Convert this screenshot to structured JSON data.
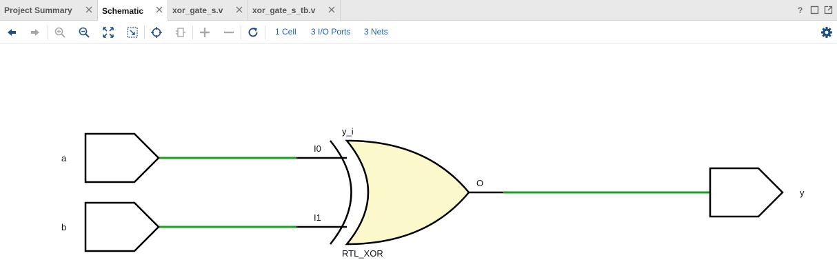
{
  "tabs": [
    {
      "label": "Project Summary",
      "active": false
    },
    {
      "label": "Schematic",
      "active": true
    },
    {
      "label": "xor_gate_s.v",
      "active": false
    },
    {
      "label": "xor_gate_s_tb.v",
      "active": false
    }
  ],
  "window_controls": [
    "help-icon",
    "restore-icon",
    "float-icon"
  ],
  "toolbar": {
    "buttons": [
      "back-icon",
      "forward-icon",
      "zoom-in-icon",
      "zoom-out-icon",
      "zoom-fit-icon",
      "zoom-area-icon",
      "select-target-icon",
      "collapse-icon",
      "expand-icon",
      "remove-icon",
      "refresh-icon"
    ],
    "cells_link": "1 Cell",
    "ports_link": "3 I/O Ports",
    "nets_link": "3 Nets",
    "settings": "gear-icon"
  },
  "schematic": {
    "inputs": [
      {
        "name": "a"
      },
      {
        "name": "b"
      }
    ],
    "output": {
      "name": "y"
    },
    "gate": {
      "instance": "y_i",
      "type": "RTL_XOR",
      "pins": {
        "in0": "I0",
        "in1": "I1",
        "out": "O"
      }
    },
    "colors": {
      "net": "#1aa01a",
      "gate_fill": "#fbf8cc",
      "stroke": "#000000",
      "link": "#1a5fb4"
    }
  }
}
